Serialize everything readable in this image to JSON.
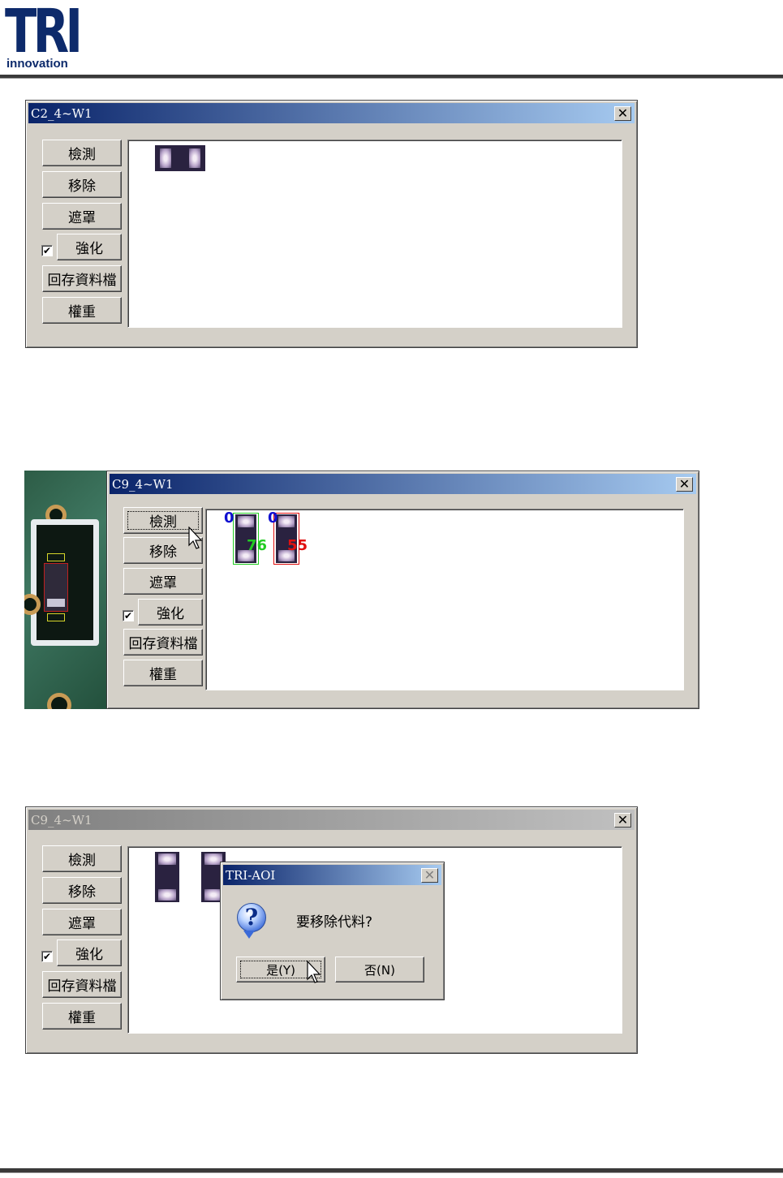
{
  "logo": {
    "main": "TRI",
    "sub": "innovation"
  },
  "windows": [
    {
      "title": "C2_4~W1",
      "buttons": [
        "檢測",
        "移除",
        "遮罩",
        "強化",
        "回存資料檔",
        "權重"
      ],
      "enhance_checked": "✔"
    },
    {
      "title": "C9_4~W1",
      "buttons": [
        "檢測",
        "移除",
        "遮罩",
        "強化",
        "回存資料檔",
        "權重"
      ],
      "enhance_checked": "✔",
      "detections": [
        {
          "index": "0",
          "score": "76",
          "color": "#22cc22"
        },
        {
          "index": "0",
          "score": "55",
          "color": "#e01010"
        }
      ]
    },
    {
      "title": "C9_4~W1",
      "buttons": [
        "檢測",
        "移除",
        "遮罩",
        "強化",
        "回存資料檔",
        "權重"
      ],
      "enhance_checked": "✔"
    }
  ],
  "dialog": {
    "title": "TRI-AOI",
    "message": "要移除代料?",
    "yes_label": "是(Y)",
    "no_label": "否(N)",
    "icon": "question-icon"
  },
  "colors": {
    "title_active": "#0a246a",
    "title_gradient_end": "#a6caf0",
    "index_color": "#1010d0"
  }
}
